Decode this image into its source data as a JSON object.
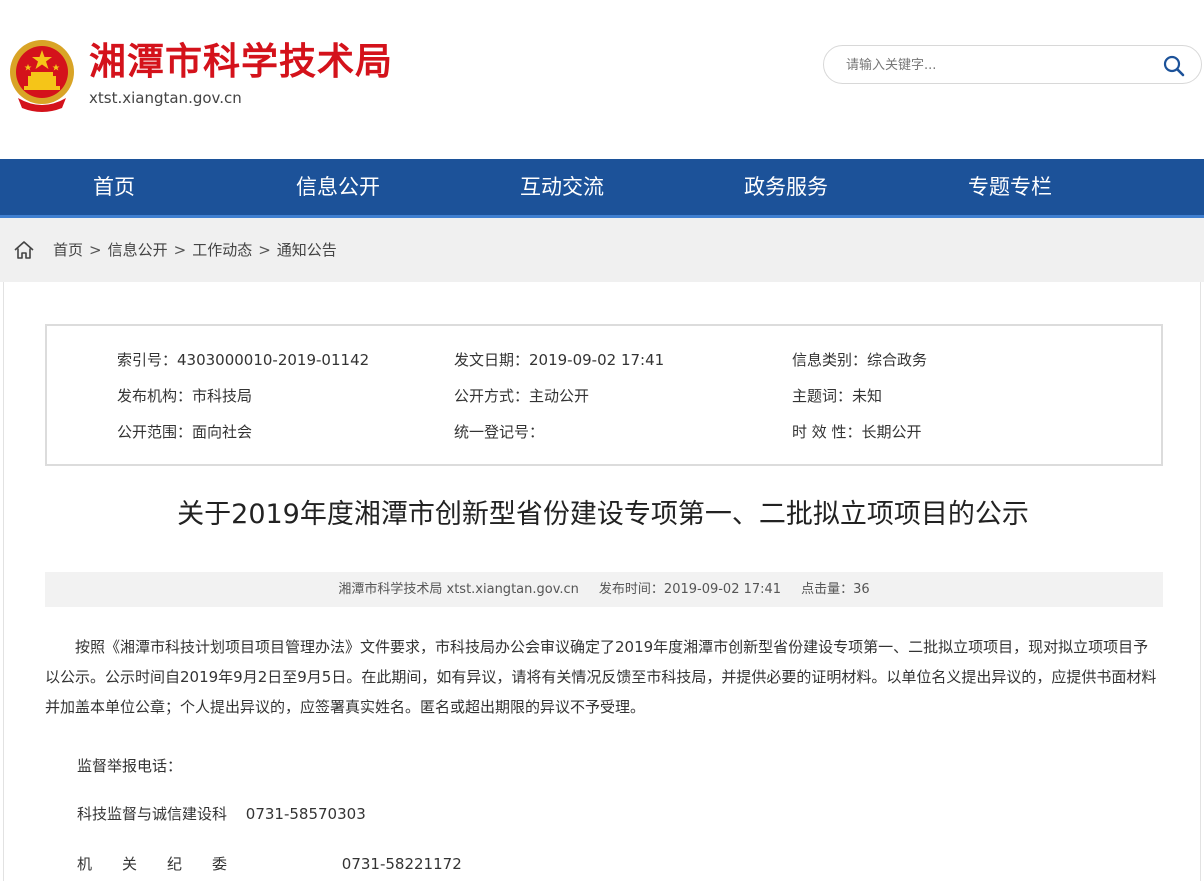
{
  "header": {
    "site_title": "湘潭市科学技术局",
    "site_domain": "xtst.xiangtan.gov.cn",
    "brand_color": "#d4121b"
  },
  "search": {
    "placeholder": "请输入关键字..."
  },
  "nav": {
    "bg_color": "#1c5299",
    "items": [
      {
        "label": "首页"
      },
      {
        "label": "信息公开"
      },
      {
        "label": "互动交流"
      },
      {
        "label": "政务服务"
      },
      {
        "label": "专题专栏"
      }
    ]
  },
  "breadcrumb": {
    "items": [
      "首页",
      "信息公开",
      "工作动态",
      "通知公告"
    ],
    "separator": ">"
  },
  "meta": {
    "index_no": "索引号：4303000010-2019-01142",
    "publish_date": "发文日期：2019-09-02 17:41",
    "info_category": "信息类别：综合政务",
    "publisher": "发布机构：市科技局",
    "disclosure_method": "公开方式：主动公开",
    "keywords": "主题词：未知",
    "disclosure_scope": "公开范围：面向社会",
    "registration_no": "统一登记号：",
    "validity": "时 效 性：长期公开"
  },
  "article": {
    "title": "关于2019年度湘潭市创新型省份建设专项第一、二批拟立项项目的公示",
    "source": "湘潭市科学技术局 xtst.xiangtan.gov.cn",
    "publish_time": "发布时间：2019-09-02 17:41",
    "views": "点击量：36",
    "paragraph": "按照《湘潭市科技计划项目项目管理办法》文件要求，市科技局办公会审议确定了2019年度湘潭市创新型省份建设专项第一、二批拟立项项目，现对拟立项项目予以公示。公示时间自2019年9月2日至9月5日。在此期间，如有异议，请将有关情况反馈至市科技局，并提供必要的证明材料。以单位名义提出异议的，应提供书面材料并加盖本单位公章；个人提出异议的，应签署真实姓名。匿名或超出期限的异议不予受理。",
    "hotline_label": "监督举报电话：",
    "contact1_name": "科技监督与诚信建设科",
    "contact1_phone": "0731-58570303",
    "contact2_name": "机　　关　　纪　　委",
    "contact2_phone": "0731-58221172"
  }
}
